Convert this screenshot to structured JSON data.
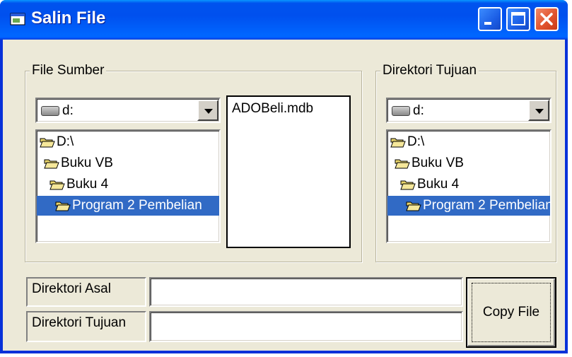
{
  "window": {
    "title": "Salin File"
  },
  "source_group": {
    "label": "File Sumber",
    "drive_value": "d:",
    "tree_items": [
      "D:\\",
      "Buku VB",
      "Buku 4",
      "Program 2 Pembelian"
    ],
    "selected_index": 3,
    "files": [
      "ADOBeli.mdb"
    ]
  },
  "dest_group": {
    "label": "Direktori Tujuan",
    "drive_value": "d:",
    "tree_items": [
      "D:\\",
      "Buku VB",
      "Buku 4",
      "Program 2 Pembelian"
    ],
    "selected_index": 3
  },
  "fields": {
    "origin_label": "Direktori Asal",
    "origin_value": "",
    "dest_label": "Direktori Tujuan",
    "dest_value": ""
  },
  "copy_button_label": "Copy File",
  "colors": {
    "titlebar": "#0054E3",
    "selection": "#316AC5",
    "face": "#ECE9D8"
  }
}
